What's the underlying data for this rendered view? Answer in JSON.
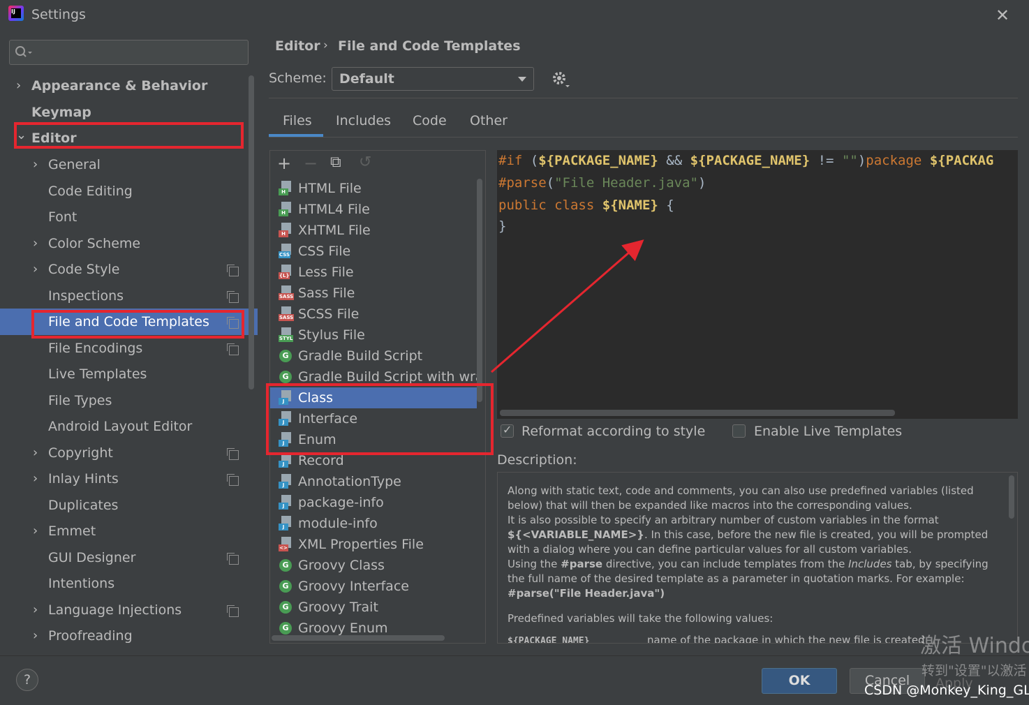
{
  "window": {
    "title": "Settings",
    "close_glyph": "✕",
    "logo_text": "IJ"
  },
  "sidebar": {
    "search_placeholder": "",
    "items": [
      {
        "label": "Appearance & Behavior",
        "chevron": "›",
        "bold": true
      },
      {
        "label": "Keymap",
        "bold": true
      },
      {
        "label": "Editor",
        "chevron": "⌄",
        "bold": true
      },
      {
        "label": "General",
        "chevron": "›"
      },
      {
        "label": "Code Editing"
      },
      {
        "label": "Font"
      },
      {
        "label": "Color Scheme",
        "chevron": "›"
      },
      {
        "label": "Code Style",
        "chevron": "›"
      },
      {
        "label": "Inspections"
      },
      {
        "label": "File and Code Templates",
        "selected": true
      },
      {
        "label": "File Encodings"
      },
      {
        "label": "Live Templates"
      },
      {
        "label": "File Types"
      },
      {
        "label": "Android Layout Editor"
      },
      {
        "label": "Copyright",
        "chevron": "›"
      },
      {
        "label": "Inlay Hints",
        "chevron": "›"
      },
      {
        "label": "Duplicates"
      },
      {
        "label": "Emmet",
        "chevron": "›"
      },
      {
        "label": "GUI Designer"
      },
      {
        "label": "Intentions"
      },
      {
        "label": "Language Injections",
        "chevron": "›"
      },
      {
        "label": "Proofreading",
        "chevron": "›"
      }
    ]
  },
  "breadcrumb": {
    "parent": "Editor",
    "separator": "›",
    "current": "File and Code Templates"
  },
  "scheme": {
    "label": "Scheme:",
    "value": "Default"
  },
  "tabs": [
    "Files",
    "Includes",
    "Code",
    "Other"
  ],
  "toolbar": {
    "add": "+",
    "remove": "−",
    "copy": "⧉",
    "reset": "↺"
  },
  "templates": [
    {
      "label": "HTML File",
      "badge": "H",
      "color": "#499c54"
    },
    {
      "label": "HTML4 File",
      "badge": "H",
      "color": "#499c54"
    },
    {
      "label": "XHTML File",
      "badge": "H",
      "color": "#c75450"
    },
    {
      "label": "CSS File",
      "badge": "CSS",
      "color": "#3592c4"
    },
    {
      "label": "Less File",
      "badge": "{L}",
      "color": "#c75450"
    },
    {
      "label": "Sass File",
      "badge": "SASS",
      "color": "#c75450"
    },
    {
      "label": "SCSS File",
      "badge": "SASS",
      "color": "#c75450"
    },
    {
      "label": "Stylus File",
      "badge": "STYL",
      "color": "#499c54"
    },
    {
      "label": "Gradle Build Script",
      "badge": "G",
      "round": true
    },
    {
      "label": "Gradle Build Script with wrapper",
      "badge": "G",
      "round": true
    },
    {
      "label": "Class",
      "badge": "J",
      "color": "#3592c4",
      "selected": true
    },
    {
      "label": "Interface",
      "badge": "J",
      "color": "#3592c4"
    },
    {
      "label": "Enum",
      "badge": "J",
      "color": "#3592c4"
    },
    {
      "label": "Record",
      "badge": "J",
      "color": "#3592c4"
    },
    {
      "label": "AnnotationType",
      "badge": "J",
      "color": "#3592c4"
    },
    {
      "label": "package-info",
      "badge": "J",
      "color": "#3592c4"
    },
    {
      "label": "module-info",
      "badge": "J",
      "color": "#3592c4"
    },
    {
      "label": "XML Properties File",
      "badge": "<>",
      "color": "#c75450"
    },
    {
      "label": "Groovy Class",
      "badge": "G",
      "round": true
    },
    {
      "label": "Groovy Interface",
      "badge": "G",
      "round": true
    },
    {
      "label": "Groovy Trait",
      "badge": "G",
      "round": true
    },
    {
      "label": "Groovy Enum",
      "badge": "G",
      "round": true
    }
  ],
  "code": {
    "line1": {
      "kw1": "#if",
      "p1": " (",
      "v1": "${PACKAGE_NAME}",
      "p2": " && ",
      "v2": "${PACKAGE_NAME}",
      "p3": " != ",
      "s1": "\"\"",
      "p4": ")",
      "kw2": "package",
      "p5": " ",
      "v3": "${PACKAG"
    },
    "line2": {
      "kw1": "#parse",
      "p1": "(",
      "s1": "\"File Header.java\"",
      "p2": ")"
    },
    "line3": {
      "kw1": "public",
      "p1": " ",
      "kw2": "class",
      "p2": " ",
      "v1": "${NAME}",
      "p3": " {"
    },
    "line4": "}"
  },
  "options": {
    "reformat_label": "Reformat according to style",
    "reformat_checked": true,
    "live_label": "Enable Live Templates",
    "live_checked": false
  },
  "description": {
    "label": "Description:",
    "p1": "Along with static text, code and comments, you can also use predefined variables (listed below) that will then be expanded like macros into the corresponding values.",
    "p2a": "It is also possible to specify an arbitrary number of custom variables in the format ",
    "p2b": "${<VARIABLE_NAME>}",
    "p2c": ". In this case, before the new file is created, you will be prompted with a dialog where you can define particular values for all custom variables.",
    "p3a": "Using the ",
    "p3b": "#parse",
    "p3c": " directive, you can include templates from the ",
    "p3d": "Includes",
    "p3e": " tab, by specifying the full name of the desired template as a parameter in quotation marks. For example:",
    "p4": "#parse(\"File Header.java\")",
    "p5": "Predefined variables will take the following values:",
    "var_name": "${PACKAGE_NAME}",
    "var_desc": "name of the package in which the new file is created"
  },
  "buttons": {
    "help": "?",
    "ok": "OK",
    "cancel": "Cancel",
    "apply": "Apply"
  },
  "watermark": {
    "line1": "激活 Windo",
    "line2": "转到\"设置\"以激活"
  },
  "credit": "CSDN @Monkey_King_GL",
  "colors": {
    "accent": "#4b6eaf",
    "highlight_box": "#e5262f",
    "editor_bg": "#2b2b2b",
    "ok_button": "#365880"
  }
}
